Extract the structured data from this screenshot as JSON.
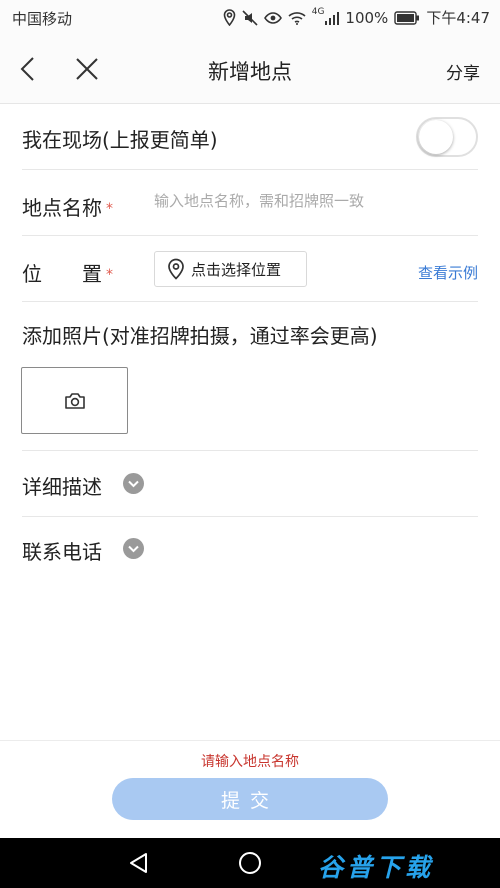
{
  "status_bar": {
    "carrier": "中国移动",
    "network": "4G",
    "battery": "100%",
    "time": "下午4:47"
  },
  "nav": {
    "title": "新增地点",
    "share_label": "分享"
  },
  "form": {
    "onsite_label": "我在现场(上报更简单)",
    "onsite_toggle_on": false,
    "name_label": "地点名称",
    "required_mark": "*",
    "name_placeholder": "输入地点名称，需和招牌照一致",
    "location_label": "位　　置",
    "location_button": "点击选择位置",
    "example_link": "查看示例",
    "photo_label": "添加照片(对准招牌拍摄，通过率会更高)",
    "detail_label": "详细描述",
    "phone_label": "联系电话"
  },
  "footer": {
    "error_message": "请输入地点名称",
    "submit_label": "提交"
  },
  "watermark": "谷普下载",
  "icons": {
    "location": "location-pin-icon",
    "camera": "camera-icon",
    "chevron": "chevron-down-icon"
  }
}
